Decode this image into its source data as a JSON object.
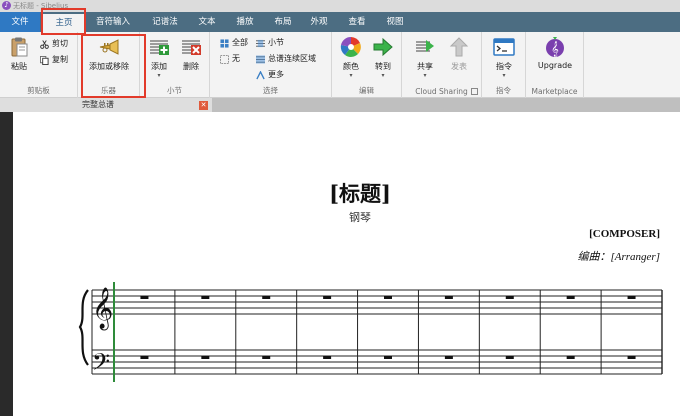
{
  "app": {
    "title": "无标题 - Sibelius",
    "logo_glyph": "♪"
  },
  "tabs": [
    {
      "key": "file",
      "label": "文件"
    },
    {
      "key": "home",
      "label": "主页"
    },
    {
      "key": "note_input",
      "label": "音符输入"
    },
    {
      "key": "notations",
      "label": "记谱法"
    },
    {
      "key": "text",
      "label": "文本"
    },
    {
      "key": "play",
      "label": "播放"
    },
    {
      "key": "layout",
      "label": "布局"
    },
    {
      "key": "appearance",
      "label": "外观"
    },
    {
      "key": "review",
      "label": "查看"
    },
    {
      "key": "view",
      "label": "视图"
    }
  ],
  "active_tab": "主页",
  "ribbon": {
    "clipboard": {
      "label": "剪贴板",
      "paste": "粘贴",
      "cut": "剪切",
      "copy": "复制"
    },
    "instruments": {
      "label": "乐器",
      "add_remove": "添加或移除"
    },
    "bars": {
      "label": "小节",
      "add": "添加",
      "delete": "删除"
    },
    "selection": {
      "label": "选择",
      "all": "全部",
      "none": "无",
      "bar": "小节",
      "system_passage": "总谱连续区域",
      "more": "更多"
    },
    "edit": {
      "label": "编辑",
      "color": "颜色",
      "goto": "转到"
    },
    "cloud_sharing": {
      "label": "Cloud Sharing",
      "share": "共享",
      "publish": "发表"
    },
    "plugins": {
      "label": "指令",
      "command": "指令"
    },
    "marketplace": {
      "label": "Marketplace",
      "upgrade": "Upgrade"
    }
  },
  "document_tab": {
    "label": "完整总谱",
    "close_glyph": "✕"
  },
  "score": {
    "title": "[标题]",
    "subtitle": "钢琴",
    "composer": "[COMPOSER]",
    "arranger": "编曲：[Arranger]",
    "bars": 9,
    "whole_rest_glyph": "▬"
  },
  "colors": {
    "tabbar": "#4c6d82",
    "file_tab": "#2f79c3",
    "ribbon": "#f3f3f3",
    "highlight": "#e23a2a",
    "selection_line": "#2e8b3a"
  }
}
